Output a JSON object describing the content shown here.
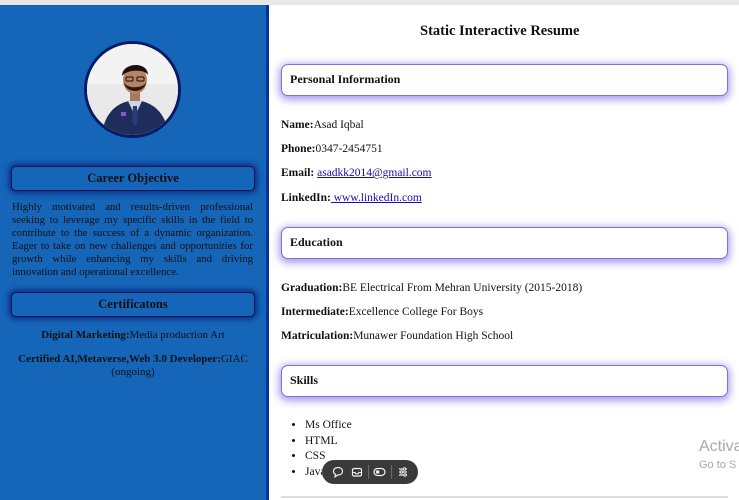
{
  "main": {
    "title": "Static Interactive Resume",
    "sections": {
      "personal": "Personal Information",
      "education": "Education",
      "skills": "Skills"
    },
    "personal": {
      "name_label": "Name:",
      "name_value": "Asad Iqbal",
      "phone_label": "Phone:",
      "phone_value": "0347-2454751",
      "email_label": "Email:",
      "email_value": "asadkk2014@gmail.com",
      "linkedin_label": "LinkedIn:",
      "linkedin_value": " www.linkedIn.com"
    },
    "education": {
      "graduation_label": "Graduation:",
      "graduation_value": "BE Electrical From Mehran University (2015-2018)",
      "intermediate_label": "Intermediate:",
      "intermediate_value": "Excellence College For Boys",
      "matriculation_label": "Matriculation:",
      "matriculation_value": "Munawer Foundation High School"
    },
    "skills": [
      "Ms Office",
      "HTML",
      "CSS",
      "Java"
    ]
  },
  "sidebar": {
    "career_heading": "Career Objective",
    "career_text": "Highly motivated and results-driven professional seeking to leverage my specific skills in the field to contribute to the success of a dynamic organization. Eager to take on new challenges and opportunities for growth while enhancing my skills and driving innovation and operational excellence.",
    "cert_heading": "Certificatons",
    "certs": [
      {
        "label": "Digital Marketing:",
        "value": "Media production Art"
      },
      {
        "label": "Certified AI,Metaverse,Web 3.0 Developer:",
        "value": "GIAC (ongoing)"
      }
    ]
  },
  "watermark": {
    "line1": "Activa",
    "line2": "Go to S"
  },
  "toolbar": {
    "icons": [
      "comment-icon",
      "inbox-icon",
      "toggle-icon",
      "settings-icon"
    ]
  },
  "colors": {
    "sidebar": "#1565b8",
    "card_border": "#7b72e0",
    "link": "#1a0dab"
  }
}
